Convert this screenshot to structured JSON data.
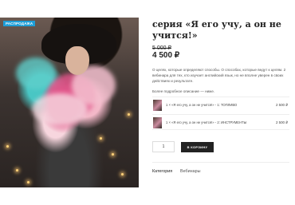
{
  "badge": {
    "label": "РАСПРОДАЖА"
  },
  "product": {
    "title": "серия «Я его учу, а он не учится!»",
    "price_old": "5 000 ₽",
    "price_new": "4 500 ₽",
    "description": "О целях, которые определяют способы. О способах, которые ведут к целям. 2 вебинара для тех, кто изучает английский язык, но не вполне уверен в своих действиях и результате.",
    "more_text": "Более подробное описание — ниже."
  },
  "bundle": [
    {
      "name": "1 × «Я его учу, а он не учится!» - 1: ТОПЛИВО",
      "price": "2 500 ₽"
    },
    {
      "name": "1 × «Я его учу, а он не учится!» - 2: ИНСТРУМЕНТЫ",
      "price": "2 500 ₽"
    }
  ],
  "cart": {
    "quantity": "1",
    "button_label": "В КОРЗИНУ"
  },
  "meta": {
    "category_label": "Категория",
    "category_value": "Вебинары"
  },
  "colors": {
    "badge": "#1e9ed8",
    "button": "#222222"
  }
}
